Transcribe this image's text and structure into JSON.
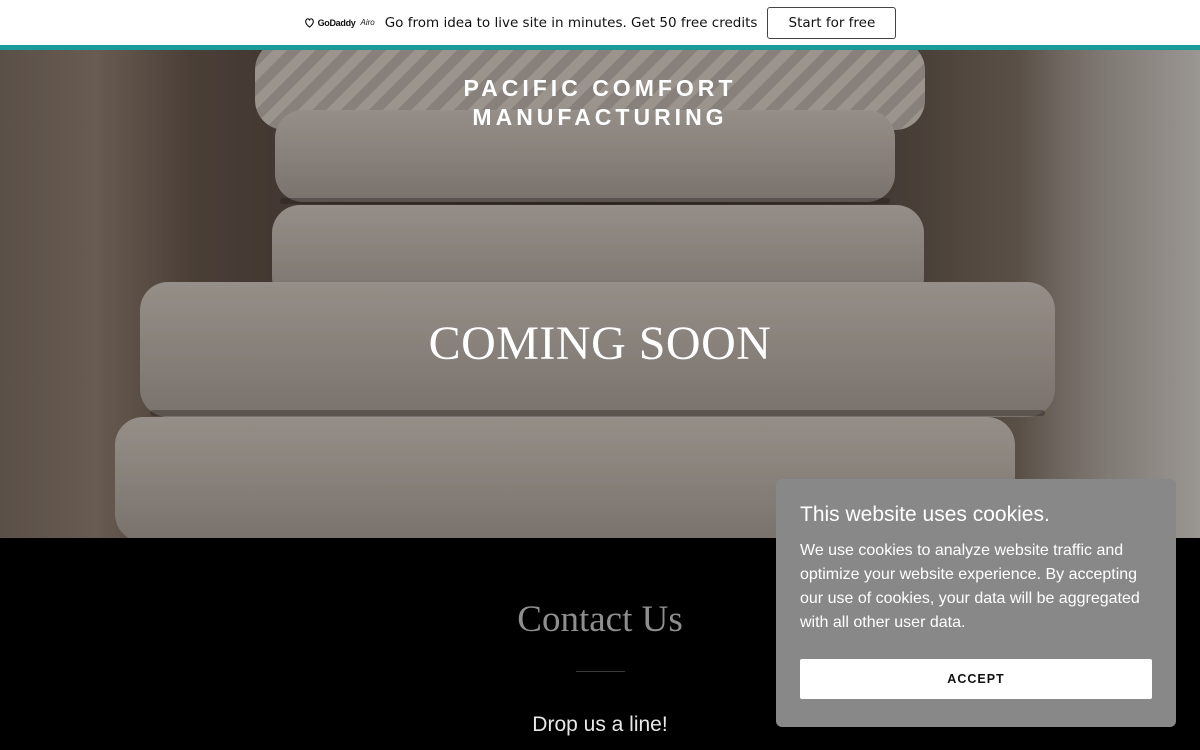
{
  "promo": {
    "logo_text": "GoDaddy",
    "logo_sub": "Airo",
    "message": "Go from idea to live site in minutes. Get 50 free credits",
    "button_label": "Start for free",
    "accent_color": "#1b9a9a"
  },
  "hero": {
    "brand_line1": "PACIFIC COMFORT",
    "brand_line2": "MANUFACTURING",
    "heading": "COMING SOON"
  },
  "contact": {
    "title": "Contact Us",
    "subtitle": "Drop us a line!"
  },
  "cookie": {
    "title": "This website uses cookies.",
    "text": "We use cookies to analyze website traffic and optimize your website experience. By accepting our use of cookies, your data will be aggregated with all other user data.",
    "accept_label": "ACCEPT",
    "background": "#888888"
  }
}
